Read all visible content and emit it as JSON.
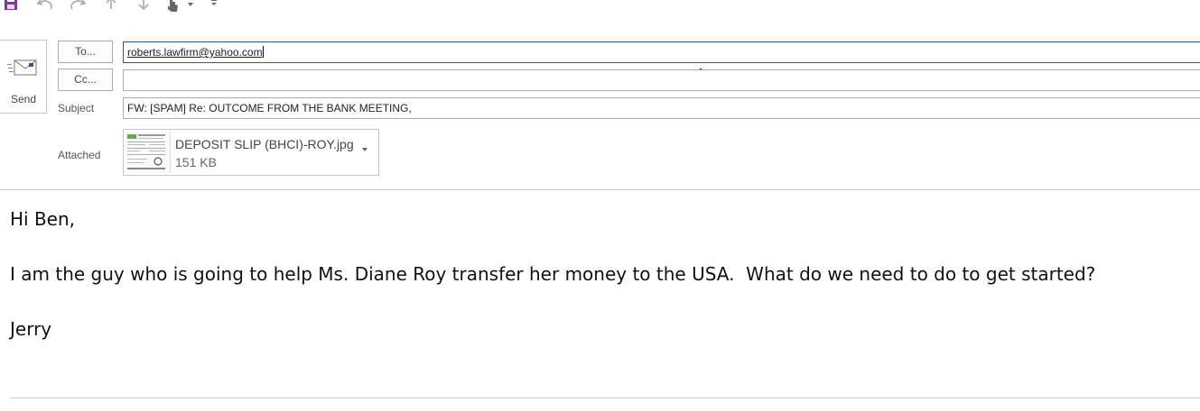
{
  "toolbar": {
    "icons": [
      "save-icon",
      "undo-icon",
      "redo-icon",
      "up-arrow-icon",
      "down-arrow-icon",
      "touch-mode-icon",
      "customize-toolbar-icon"
    ]
  },
  "compose": {
    "send_label": "Send",
    "to_button": "To...",
    "cc_button": "Cc...",
    "subject_label": "Subject",
    "attached_label": "Attached",
    "to_value": "roberts.lawfirm@yahoo.com",
    "cc_value": "",
    "subject_value": "FW: [SPAM] Re: OUTCOME FROM THE BANK MEETING,"
  },
  "attachment": {
    "name": "DEPOSIT SLIP (BHCI)-ROY.jpg",
    "size": "151 KB"
  },
  "body": {
    "greeting": "Hi Ben,",
    "paragraph": "I am the guy who is going to help Ms. Diane Roy transfer her money to the USA.  What do we need to do to get started?",
    "signature": "Jerry"
  },
  "colors": {
    "accent": "#2b579a",
    "save_icon": "#7a3b9a",
    "border": "#ababab"
  }
}
